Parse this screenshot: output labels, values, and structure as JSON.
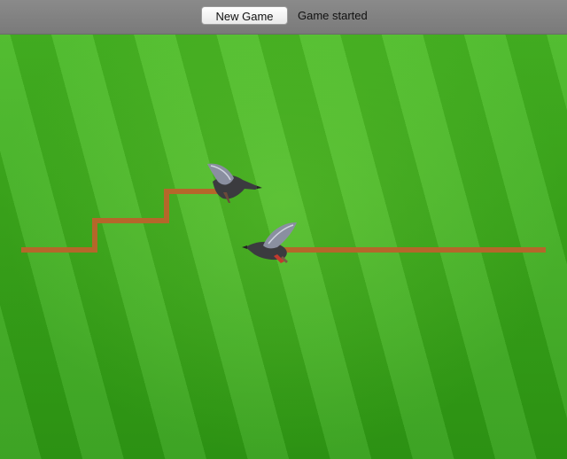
{
  "toolbar": {
    "new_game_label": "New Game",
    "status_text": "Game started"
  },
  "game": {
    "colors": {
      "grass": "#3fae1f",
      "path": "#b5672a"
    },
    "sprites": [
      "goose-icon",
      "goose-icon"
    ]
  }
}
